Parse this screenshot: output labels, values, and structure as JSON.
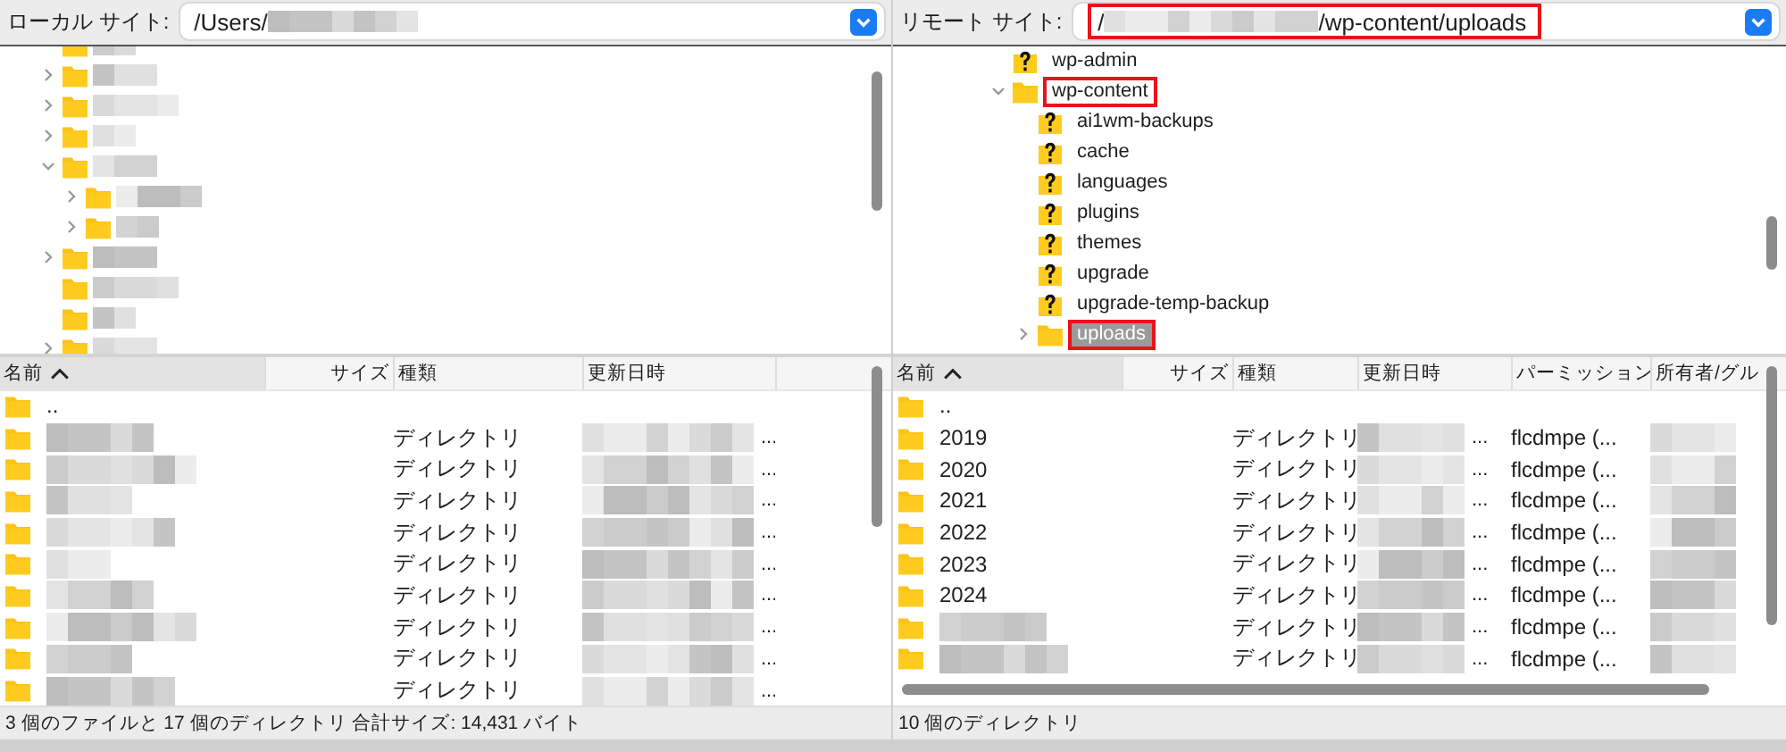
{
  "local": {
    "site_label": "ローカル サイト:",
    "path": "/Users/",
    "tree": [
      {
        "expandable": false
      },
      {
        "expandable": true,
        "expanded": false
      },
      {
        "expandable": true,
        "expanded": false
      },
      {
        "expandable": true,
        "expanded": false
      },
      {
        "expandable": true,
        "expanded": true,
        "children": [
          {
            "expandable": true,
            "expanded": false
          },
          {
            "expandable": true,
            "expanded": false
          }
        ]
      },
      {
        "expandable": true,
        "expanded": false
      },
      {
        "expandable": false
      },
      {
        "expandable": false
      },
      {
        "expandable": true,
        "expanded": false
      }
    ],
    "columns": [
      {
        "label": "名前",
        "sorted": true
      },
      {
        "label": "サイズ",
        "sorted": false
      },
      {
        "label": "種類",
        "sorted": false
      },
      {
        "label": "更新日時",
        "sorted": false
      }
    ],
    "rows": [
      {
        "name": ".."
      },
      {
        "type": "ディレクトリ",
        "modified": "..."
      },
      {
        "type": "ディレクトリ",
        "modified": "..."
      },
      {
        "type": "ディレクトリ",
        "modified": "..."
      },
      {
        "type": "ディレクトリ",
        "modified": "..."
      },
      {
        "type": "ディレクトリ",
        "modified": "..."
      },
      {
        "type": "ディレクトリ",
        "modified": "..."
      },
      {
        "type": "ディレクトリ",
        "modified": "..."
      },
      {
        "type": "ディレクトリ",
        "modified": "..."
      },
      {
        "type": "ディレクトリ",
        "modified": "..."
      }
    ],
    "status": "3 個のファイルと 17 個のディレクトリ 合計サイズ: 14,431 バイト"
  },
  "remote": {
    "site_label": "リモート サイト:",
    "path_prefix": "/",
    "path_suffix": "/wp-content/uploads",
    "path_highlighted": true,
    "tree": [
      {
        "name": "wp-admin",
        "kind": "unknown",
        "highlighted": false,
        "selected": false
      },
      {
        "name": "wp-content",
        "kind": "folder",
        "expanded": true,
        "highlighted": true,
        "selected": false,
        "children": [
          {
            "name": "ai1wm-backups",
            "kind": "unknown",
            "highlighted": false,
            "selected": false
          },
          {
            "name": "cache",
            "kind": "unknown",
            "highlighted": false,
            "selected": false
          },
          {
            "name": "languages",
            "kind": "unknown",
            "highlighted": false,
            "selected": false
          },
          {
            "name": "plugins",
            "kind": "unknown",
            "highlighted": false,
            "selected": false
          },
          {
            "name": "themes",
            "kind": "unknown",
            "highlighted": false,
            "selected": false
          },
          {
            "name": "upgrade",
            "kind": "unknown",
            "highlighted": false,
            "selected": false
          },
          {
            "name": "upgrade-temp-backup",
            "kind": "unknown",
            "highlighted": false,
            "selected": false
          },
          {
            "name": "uploads",
            "kind": "folder",
            "expanded": false,
            "highlighted": true,
            "selected": true
          }
        ]
      }
    ],
    "columns": [
      {
        "label": "名前",
        "sorted": true
      },
      {
        "label": "サイズ",
        "sorted": false
      },
      {
        "label": "種類",
        "sorted": false
      },
      {
        "label": "更新日時",
        "sorted": false
      },
      {
        "label": "パーミッション",
        "sorted": false
      },
      {
        "label": "所有者/グル",
        "sorted": false
      }
    ],
    "rows": [
      {
        "name": ".."
      },
      {
        "name": "2019",
        "type": "ディレクトリ",
        "modified": "...",
        "permissions": "flcdmpe (..."
      },
      {
        "name": "2020",
        "type": "ディレクトリ",
        "modified": "...",
        "permissions": "flcdmpe (..."
      },
      {
        "name": "2021",
        "type": "ディレクトリ",
        "modified": "...",
        "permissions": "flcdmpe (..."
      },
      {
        "name": "2022",
        "type": "ディレクトリ",
        "modified": "...",
        "permissions": "flcdmpe (..."
      },
      {
        "name": "2023",
        "type": "ディレクトリ",
        "modified": "...",
        "permissions": "flcdmpe (..."
      },
      {
        "name": "2024",
        "type": "ディレクトリ",
        "modified": "...",
        "permissions": "flcdmpe (..."
      },
      {
        "type": "ディレクトリ",
        "modified": "...",
        "permissions": "flcdmpe (..."
      },
      {
        "type": "ディレクトリ",
        "modified": "...",
        "permissions": "flcdmpe (..."
      }
    ],
    "status": "10 個のディレクトリ"
  }
}
